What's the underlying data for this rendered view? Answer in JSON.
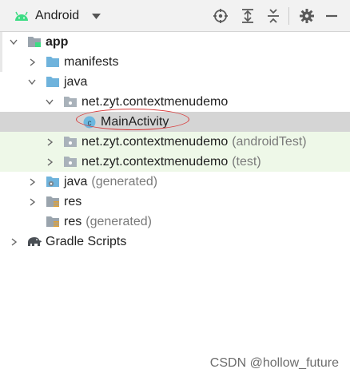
{
  "toolbar": {
    "view_label": "Android",
    "icons": [
      "locate-icon",
      "expand-all-icon",
      "collapse-all-icon",
      "settings-icon",
      "hide-panel-icon"
    ]
  },
  "tree": {
    "app": "app",
    "manifests": "manifests",
    "java": "java",
    "package_main": "net.zyt.contextmenudemo",
    "main_activity": "MainActivity",
    "package_android_test": "net.zyt.contextmenudemo",
    "android_test_suffix": "(androidTest)",
    "package_test": "net.zyt.contextmenudemo",
    "test_suffix": "(test)",
    "java_generated": "java",
    "java_generated_suffix": "(generated)",
    "res": "res",
    "res_generated": "res",
    "res_generated_suffix": "(generated)",
    "gradle_scripts": "Gradle Scripts"
  },
  "colors": {
    "toolbar_bg": "#f2f2f2",
    "selected_row": "#d5d5d5",
    "test_row": "#eef8e8",
    "android_green": "#3ddc84",
    "folder_blue": "#6fb3dc",
    "folder_gray": "#9aa4ad",
    "annotation_red": "#d93a3a"
  },
  "watermark": "CSDN @hollow_future"
}
